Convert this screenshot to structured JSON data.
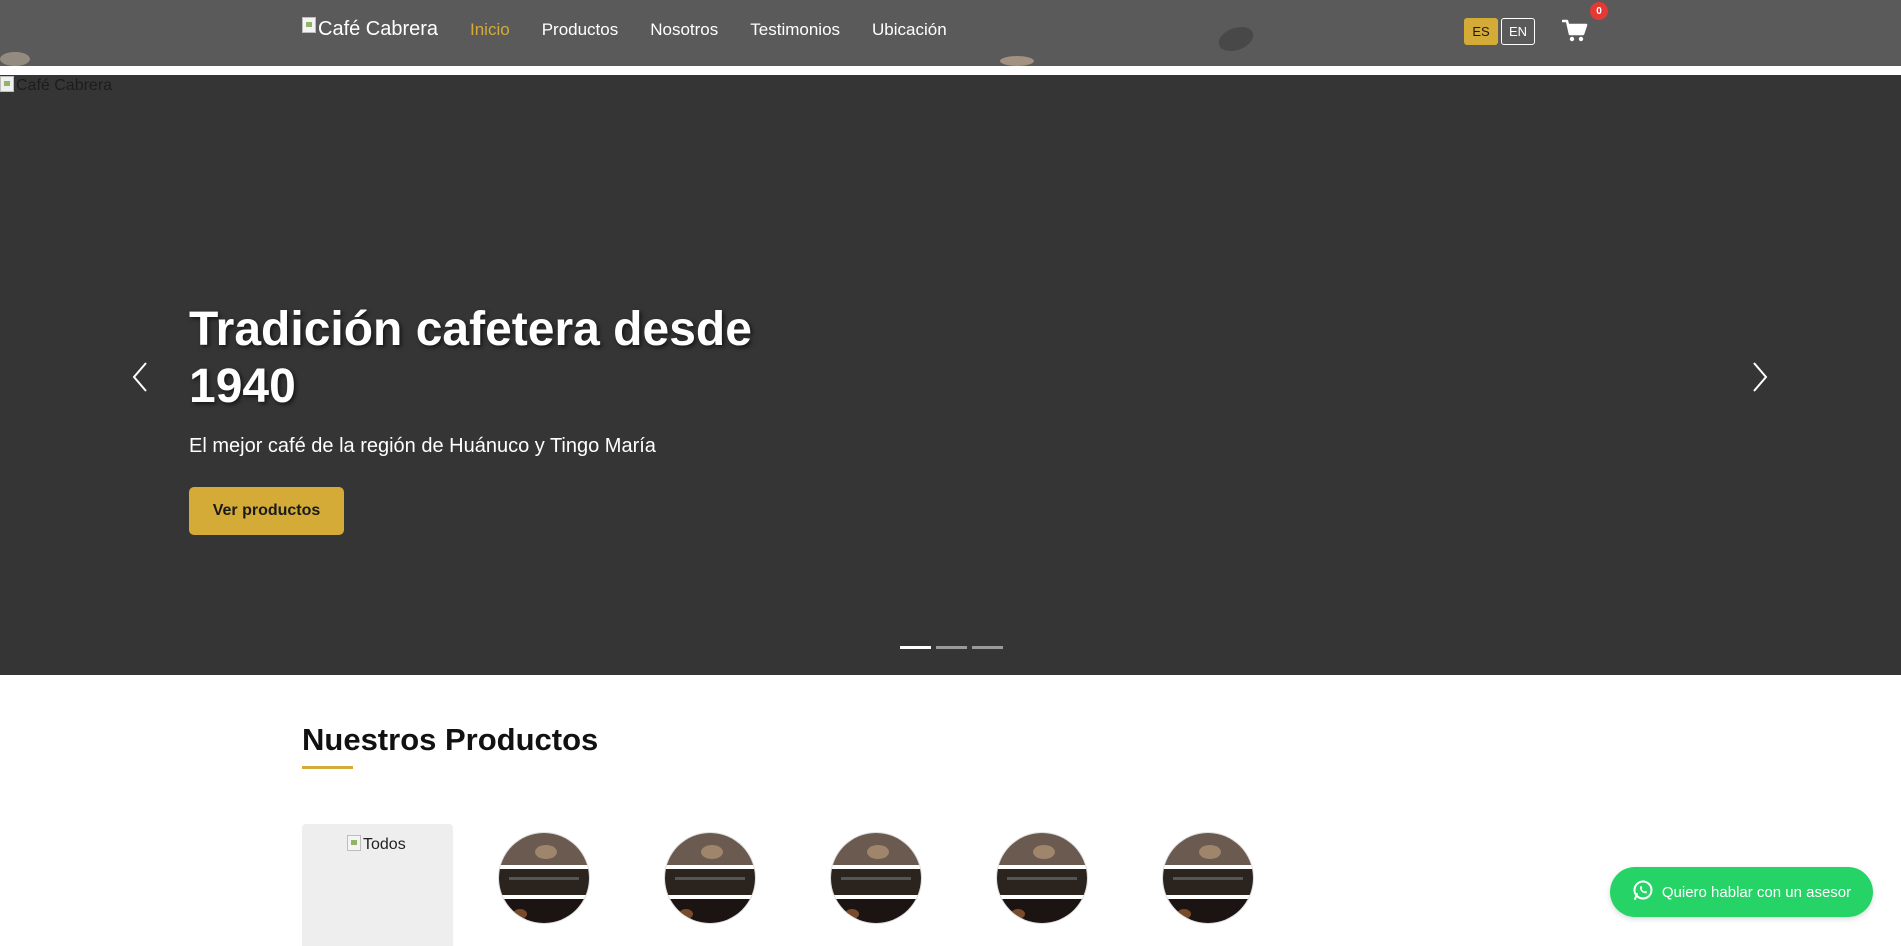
{
  "header": {
    "brand_alt": "Café Cabrera",
    "nav": [
      "Inicio",
      "Productos",
      "Nosotros",
      "Testimonios",
      "Ubicación"
    ],
    "lang_es": "ES",
    "lang_en": "EN",
    "cart_count": "0"
  },
  "hero": {
    "image_alt": "Café Cabrera",
    "title": "Tradición cafetera desde 1940",
    "subtitle": "El mejor café de la región de Huánuco y Tingo María",
    "cta": "Ver productos",
    "slide_count": 3,
    "active_slide": 1
  },
  "products": {
    "title": "Nuestros Productos",
    "first_category_alt": "Todos"
  },
  "whatsapp": {
    "label": "Quiero hablar con un asesor"
  },
  "colors": {
    "accent": "#d4ab37",
    "navbar": "#5a5a5a",
    "hero_bg": "#353535",
    "whatsapp": "#25d366",
    "badge": "#e53935"
  }
}
